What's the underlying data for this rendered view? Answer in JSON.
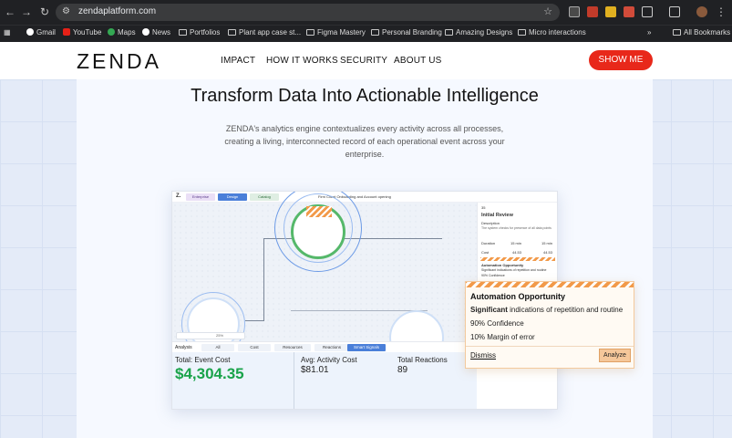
{
  "browser": {
    "url": "zendaplatform.com",
    "bookmarks": [
      "Gmail",
      "YouTube",
      "Maps",
      "News",
      "Portfolios",
      "Plant app case st...",
      "Figma Mastery",
      "Personal Branding",
      "Amazing Designs",
      "Micro interactions"
    ],
    "all_bookmarks": "All Bookmarks",
    "more": "»"
  },
  "header": {
    "logo": "ZENDA",
    "nav": [
      "IMPACT",
      "HOW IT WORKS",
      "SECURITY",
      "ABOUT US"
    ],
    "cta": "SHOW ME"
  },
  "hero": {
    "title": "Transform Data Into Actionable Intelligence",
    "subtitle": "ZENDA's analytics engine contextualizes every activity across all processes, creating a living, interconnected record of each operational event across your enterprise."
  },
  "mock": {
    "logo": "Z.",
    "tabs": [
      "Enterprise",
      "Design",
      "Catalog"
    ],
    "title": "Firm Client Onboarding and Account opening",
    "zoom": "25%",
    "panel": {
      "id": "35",
      "heading": "Initial Review",
      "description_label": "Description",
      "description": "The system checks for presence of all data points",
      "duration_label": "Duration",
      "duration_a": "15 min",
      "duration_b": "15 min",
      "cost_label": "Cost",
      "cost_a": "44.53",
      "cost_b": "44.53",
      "opportunity": "Automation Opportunity",
      "opportunity_text": "Significant indications of repetition and routine",
      "confidence": "90% Confidence"
    },
    "analysis_label": "Analysis",
    "analysis_tabs": [
      "All",
      "Cost",
      "Resources",
      "Reactions",
      "Smart Signals"
    ],
    "stats": {
      "total_event_cost_label": "Total: Event Cost",
      "total_event_cost": "$4,304.35",
      "avg_activity_cost_label": "Avg: Activity Cost",
      "avg_activity_cost": "$81.01",
      "total_reactions_label": "Total Reactions",
      "total_reactions": "89"
    }
  },
  "popup": {
    "title": "Automation Opportunity",
    "significant": "Significant",
    "significant_rest": " indications of repetition and routine",
    "confidence": "90% Confidence",
    "margin": "10% Margin of error",
    "dismiss": "Dismiss",
    "analyze": "Analyze"
  },
  "colors": {
    "accent_red": "#e8281a",
    "stat_green": "#1aa34a",
    "opportunity_orange": "#f29a4a",
    "tab_blue": "#4a7fd9"
  }
}
